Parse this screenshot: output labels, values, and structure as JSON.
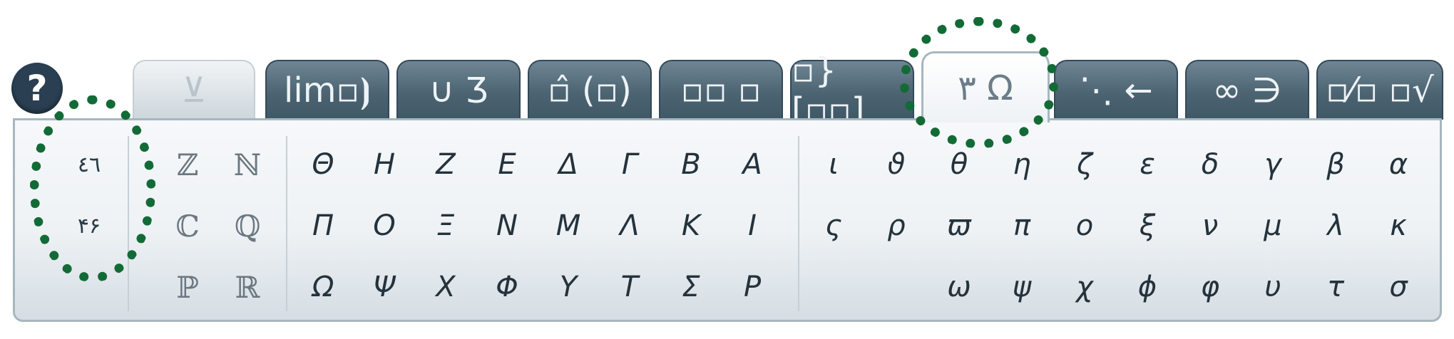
{
  "toolbar": {
    "help_label": "?",
    "tabs": [
      {
        "label": "⊻",
        "icon": "insert-icon",
        "state": "disabled"
      },
      {
        "label": "lim▫⦘",
        "icon": "limits-icon",
        "state": "normal"
      },
      {
        "label": "∪ Ʒ",
        "icon": "operators-icon",
        "state": "normal"
      },
      {
        "label": "▫̂ (▫)",
        "icon": "accents-brackets-icon",
        "state": "normal"
      },
      {
        "label": "▫▫ ▫",
        "icon": "layout-icon",
        "state": "normal"
      },
      {
        "label": "▫} [▫▫]",
        "icon": "matrix-icon",
        "state": "normal"
      },
      {
        "label": "٣ Ω",
        "icon": "greek-letters-icon",
        "state": "active"
      },
      {
        "label": "⋱ ←",
        "icon": "arrows-dots-icon",
        "state": "normal"
      },
      {
        "label": "∞ ∋",
        "icon": "symbols-icon",
        "state": "normal"
      },
      {
        "label": "▫⁄▫ ▫√",
        "icon": "fraction-root-icon",
        "state": "normal"
      }
    ]
  },
  "panel": {
    "digit_styles": [
      "٤٦",
      "۴۶"
    ],
    "number_sets": {
      "row1": [
        "ℤ",
        "ℕ"
      ],
      "row2": [
        "ℂ",
        "ℚ"
      ],
      "row3": [
        "ℙ",
        "ℝ"
      ]
    },
    "greek_upper": {
      "row1": [
        "Θ",
        "Η",
        "Ζ",
        "Ε",
        "Δ",
        "Γ",
        "Β",
        "Α"
      ],
      "row2": [
        "Π",
        "Ο",
        "Ξ",
        "Ν",
        "Μ",
        "Λ",
        "Κ",
        "Ι"
      ],
      "row3": [
        "Ω",
        "Ψ",
        "Χ",
        "Φ",
        "Υ",
        "Τ",
        "Σ",
        "Ρ"
      ]
    },
    "greek_lower": {
      "row1": [
        "ι",
        "ϑ",
        "θ",
        "η",
        "ζ",
        "ε",
        "δ",
        "γ",
        "β",
        "α"
      ],
      "row2": [
        "ς",
        "ρ",
        "ϖ",
        "π",
        "ο",
        "ξ",
        "ν",
        "μ",
        "λ",
        "κ"
      ],
      "row3": [
        "ω",
        "ψ",
        "χ",
        "ϕ",
        "φ",
        "υ",
        "τ",
        "σ"
      ]
    }
  },
  "colors": {
    "highlight_ring": "#126b36",
    "tab_dark": "#4c6472",
    "help_bg": "#2a3f52"
  }
}
